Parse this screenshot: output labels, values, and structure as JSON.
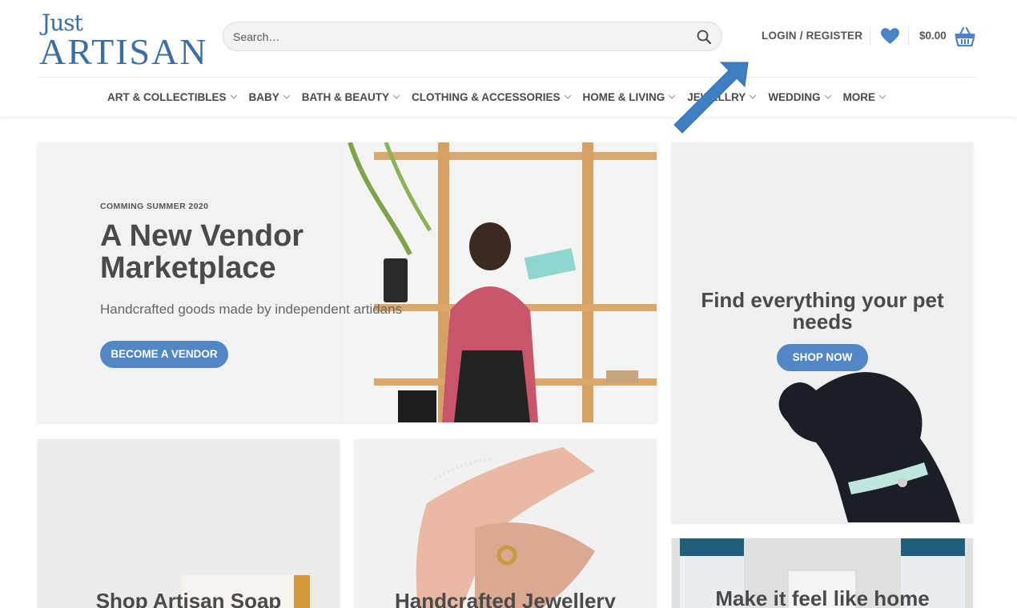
{
  "header": {
    "logo_top": "Just",
    "logo_bottom": "ARTISAN",
    "search_placeholder": "Search…",
    "account_label": "LOGIN / REGISTER",
    "cart_total": "$0.00"
  },
  "nav": {
    "items": [
      {
        "label": "ART & COLLECTIBLES"
      },
      {
        "label": "BABY"
      },
      {
        "label": "BATH & BEAUTY"
      },
      {
        "label": "CLOTHING & ACCESSORIES"
      },
      {
        "label": "HOME & LIVING"
      },
      {
        "label": "JEWELLRY"
      },
      {
        "label": "WEDDING"
      },
      {
        "label": "MORE"
      }
    ]
  },
  "hero": {
    "label": "COMMING SUMMER 2020",
    "title": "A New Vendor Marketplace",
    "subtitle": "Handcrafted goods made by independent artidans",
    "button": "BECOME A VENDOR"
  },
  "pet": {
    "title": "Find everything your pet needs",
    "button": "SHOP NOW"
  },
  "tiles": {
    "soap": "Shop Artisan Soap",
    "jewellery": "Handcrafted Jewellery",
    "home": "Make it feel like home"
  },
  "colors": {
    "brand": "#3a6ea5",
    "button": "#5087c4",
    "arrow": "#3f7fc4"
  }
}
